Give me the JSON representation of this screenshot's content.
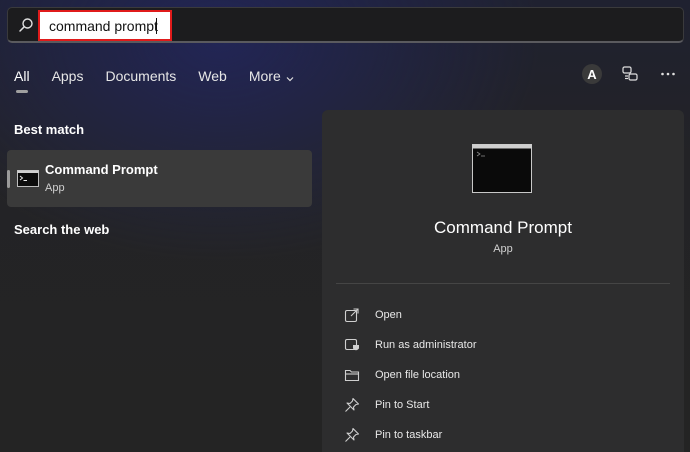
{
  "search": {
    "value": "command prompt",
    "icon": "search-icon",
    "highlight_color": "#e01b1b"
  },
  "tabs": [
    {
      "label": "All",
      "active": true
    },
    {
      "label": "Apps"
    },
    {
      "label": "Documents"
    },
    {
      "label": "Web"
    },
    {
      "label": "More"
    }
  ],
  "top_actions": {
    "avatar_letter": "A",
    "icons": [
      "feedback-icon",
      "more-options-icon"
    ]
  },
  "best_match": {
    "heading": "Best match",
    "item": {
      "name": "Command Prompt",
      "type": "App",
      "icon": "command-prompt-icon"
    }
  },
  "search_web": {
    "heading": "Search the web"
  },
  "detail": {
    "name": "Command Prompt",
    "type": "App",
    "actions": [
      {
        "label": "Open",
        "icon": "open-icon"
      },
      {
        "label": "Run as administrator",
        "icon": "run-as-admin-icon"
      },
      {
        "label": "Open file location",
        "icon": "folder-icon"
      },
      {
        "label": "Pin to Start",
        "icon": "pin-icon"
      },
      {
        "label": "Pin to taskbar",
        "icon": "pin-icon"
      }
    ]
  }
}
